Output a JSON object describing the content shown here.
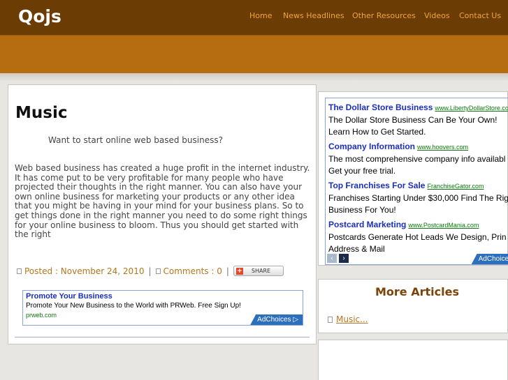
{
  "site": {
    "logo": "Qojs"
  },
  "nav": [
    {
      "label": "Home"
    },
    {
      "label": "News Headlines"
    },
    {
      "label": "Other Resources"
    },
    {
      "label": "Videos"
    },
    {
      "label": "Contact Us"
    }
  ],
  "colors": {
    "header": "#6b3d05",
    "banner": "#b66d0f",
    "accent": "#f0a43a",
    "link": "#b4761c",
    "ad_title": "#1a2ec0",
    "ad_url": "#0a7a0a"
  },
  "article": {
    "title": "Music",
    "lead": "Want to start online web based business?",
    "body": "Web based business has created a huge profit in the internet industry. It has come put to be very profitable for many people who have projected their thoughts in the right manner. You can also have your own online business for marketing your products or any other idea that you might be having in your mind for your business plans. So to get things done in the right manner you need to do some right things for your online business to bloom. Thus you should get started with the right",
    "posted": "Posted : November 24, 2010",
    "comments": "Comments : 0",
    "share_label": "SHARE",
    "sep": "|"
  },
  "inline_ad": {
    "title": "Promote Your Business",
    "desc": "Promote Your New Business to the World with PRWeb. Free Sign Up!",
    "url": "prweb.com",
    "choices": "AdChoices ▷"
  },
  "sidebar_ads": {
    "items": [
      {
        "title": "The Dollar Store Business",
        "url": "www.LibertyDollarStore.co",
        "line1": "The Dollar Store Business Can Be Your Own!",
        "line2": "Learn How to Get Started."
      },
      {
        "title": "Company Information",
        "url": "www.hoovers.com",
        "line1": "The most comprehensive company info availabl",
        "line2": "Get your free trial."
      },
      {
        "title": "Top Franchises For Sale",
        "url": "FranchiseGator.com",
        "line1": "Franchises Starting Under $30,000 Find The Rig",
        "line2": "Business For You!"
      },
      {
        "title": "Postcard Marketing",
        "url": "www.PostcardMania.com",
        "line1": "Postcards Generate Hot Leads We Design, Prin",
        "line2": "Address & Mail"
      }
    ],
    "prev": "‹",
    "next": "›",
    "choices": "AdChoice"
  },
  "more_articles": {
    "heading": "More Articles",
    "links": [
      {
        "label": "Music..."
      }
    ]
  }
}
